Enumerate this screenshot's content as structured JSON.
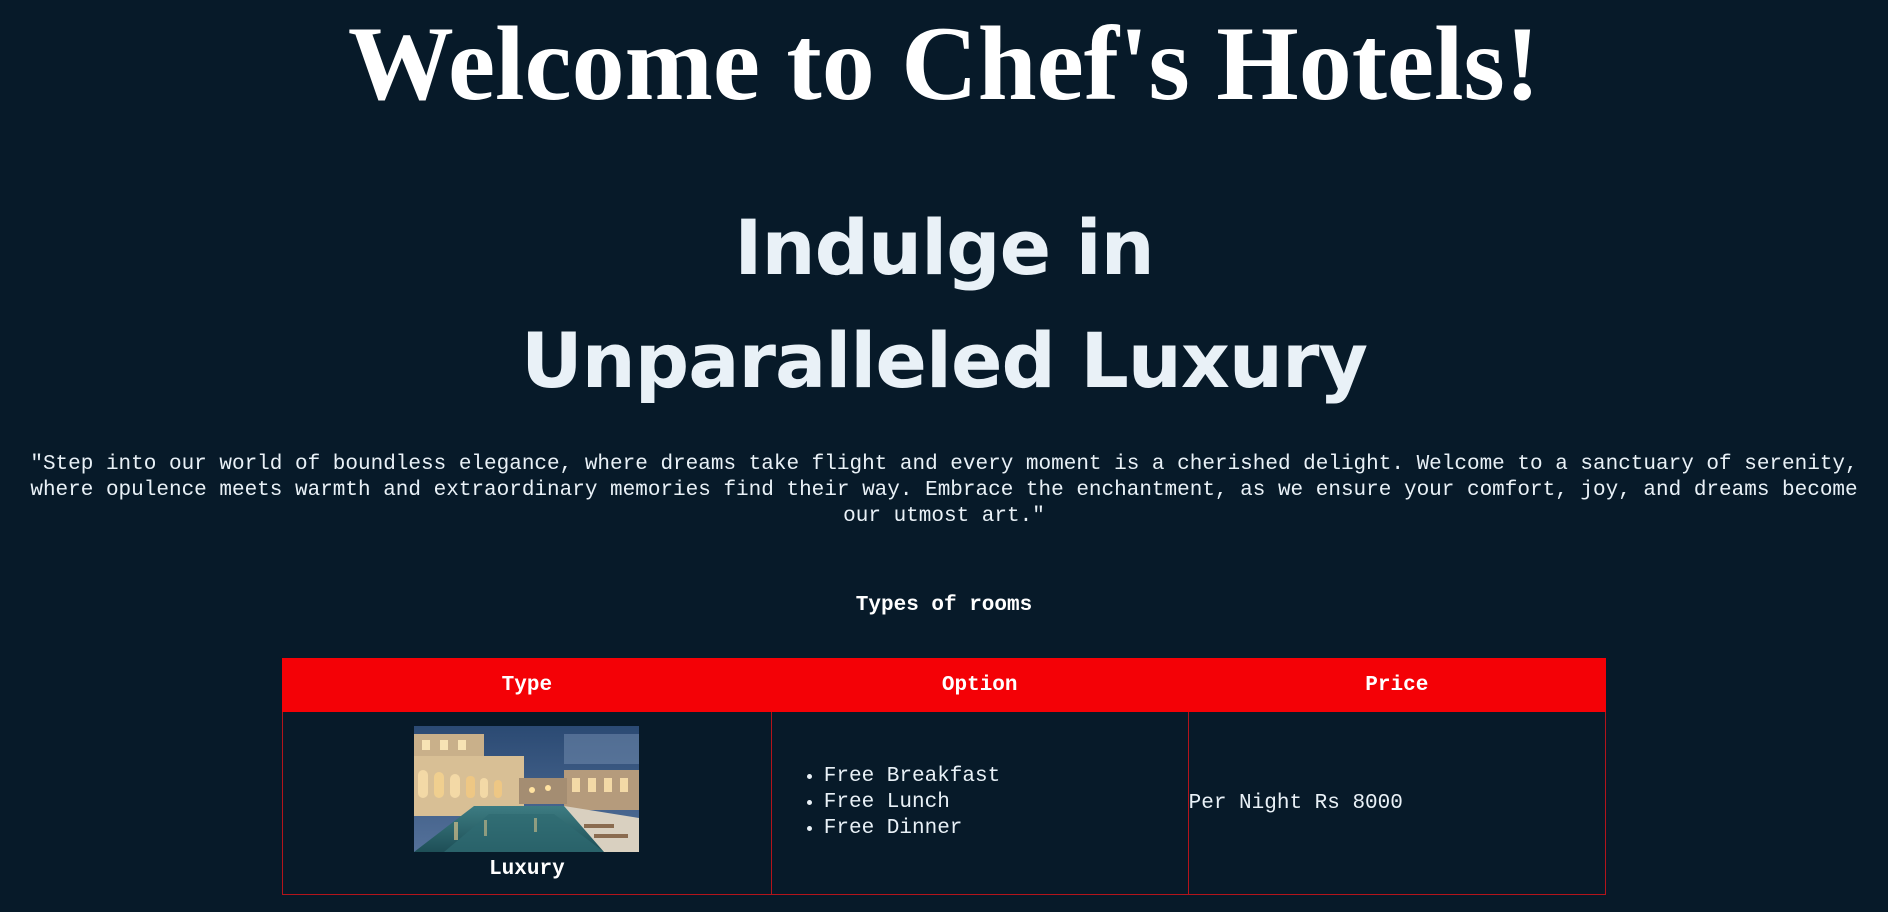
{
  "header": {
    "title": "Welcome to Chef's Hotels!",
    "tagline_line1": "Indulge in",
    "tagline_line2": "Unparalleled Luxury"
  },
  "intro": {
    "quote": "\"Step into our world of boundless elegance, where dreams take flight and every moment is a cherished delight. Welcome to a sanctuary of serenity, where opulence meets warmth and extraordinary memories find their way. Embrace the enchantment, as we ensure your comfort, joy, and dreams become our utmost art.\""
  },
  "rooms": {
    "section_title": "Types of rooms",
    "columns": [
      "Type",
      "Option",
      "Price"
    ],
    "rows": [
      {
        "type": "Luxury",
        "image": "hotel-pool-night-photo",
        "options": [
          "Free Breakfast",
          "Free Lunch",
          "Free Dinner"
        ],
        "price": "Per Night Rs 8000"
      }
    ]
  },
  "colors": {
    "background": "#071a29",
    "table_header": "#f40106",
    "table_border": "#b3141b",
    "text": "#e9f1f7"
  }
}
